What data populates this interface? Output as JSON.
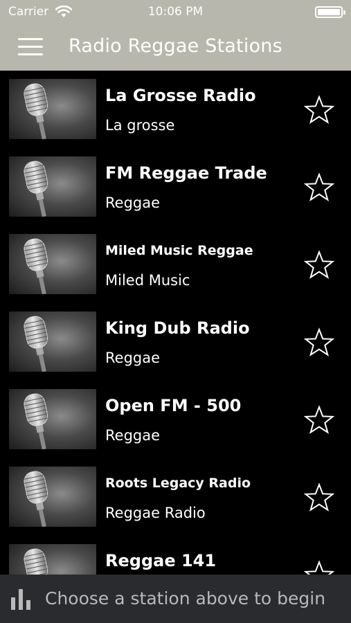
{
  "status_bar": {
    "carrier": "Carrier",
    "time": "10:06 PM"
  },
  "nav": {
    "title": "Radio Reggae Stations",
    "menu_icon": "hamburger-menu-icon"
  },
  "stations": [
    {
      "name": "La Grosse Radio",
      "subtitle": "La grosse",
      "favorite": false
    },
    {
      "name": "FM Reggae Trade",
      "subtitle": "Reggae",
      "favorite": false
    },
    {
      "name": "Miled Music Reggae",
      "subtitle": "Miled Music",
      "favorite": false
    },
    {
      "name": "King Dub Radio",
      "subtitle": "Reggae",
      "favorite": false
    },
    {
      "name": "Open FM - 500",
      "subtitle": "Reggae",
      "favorite": false
    },
    {
      "name": "Roots Legacy Radio",
      "subtitle": "Reggae Radio",
      "favorite": false
    },
    {
      "name": "Reggae 141",
      "subtitle": "",
      "favorite": false
    }
  ],
  "player": {
    "icon": "equalizer-icon",
    "prompt": "Choose a station above to begin"
  },
  "colors": {
    "nav_background": "#b8b7ad",
    "list_background": "#000000",
    "player_background": "#2a2b2e"
  }
}
